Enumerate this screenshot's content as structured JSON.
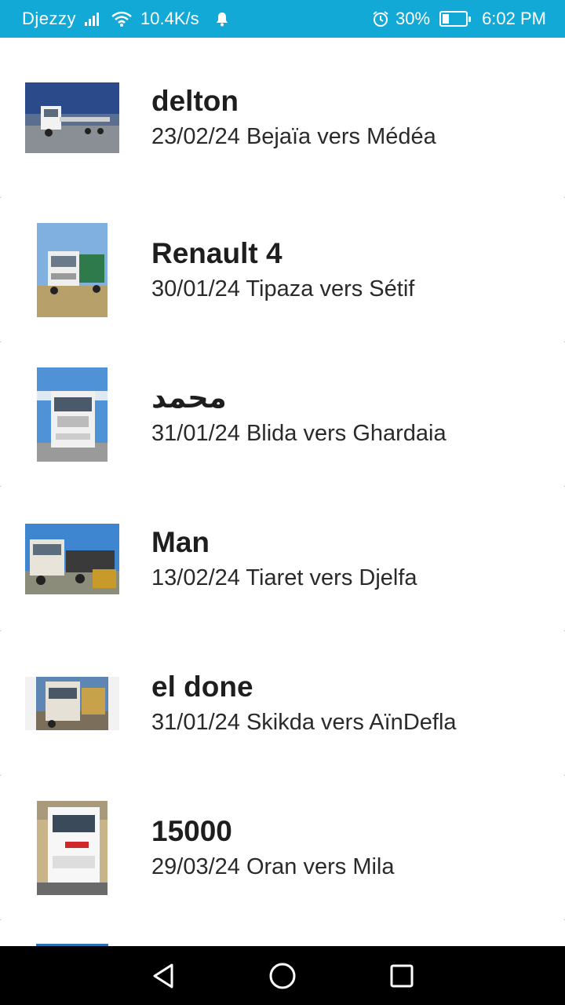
{
  "status_bar": {
    "carrier": "Djezzy",
    "net_speed": "10.4K/s",
    "battery_percent": "30%",
    "battery_level": 0.3,
    "time": "6:02 PM",
    "icons": [
      "signal-icon",
      "wifi-icon",
      "notification-bell-icon",
      "alarm-icon",
      "battery-icon"
    ]
  },
  "trips": [
    {
      "title": "delton",
      "subtitle": "23/02/24 Bejaïa vers Médéa",
      "thumb": "truck-photo"
    },
    {
      "title": "Renault 4",
      "subtitle": "30/01/24 Tipaza vers Sétif",
      "thumb": "truck-photo"
    },
    {
      "title": "محمد",
      "subtitle": "31/01/24 Blida vers Ghardaia",
      "thumb": "truck-photo"
    },
    {
      "title": "Man",
      "subtitle": "13/02/24 Tiaret vers Djelfa",
      "thumb": "truck-photo"
    },
    {
      "title": "el done",
      "subtitle": "31/01/24 Skikda vers AïnDefla",
      "thumb": "truck-photo"
    },
    {
      "title": "15000",
      "subtitle": "29/03/24 Oran vers Mila",
      "thumb": "truck-photo"
    }
  ],
  "nav_bar": {
    "buttons": [
      "back-icon",
      "home-icon",
      "recents-icon"
    ]
  },
  "colors": {
    "status_bar": "#12a9d6",
    "nav_bar": "#000000",
    "title_text": "#1e1e1e"
  }
}
